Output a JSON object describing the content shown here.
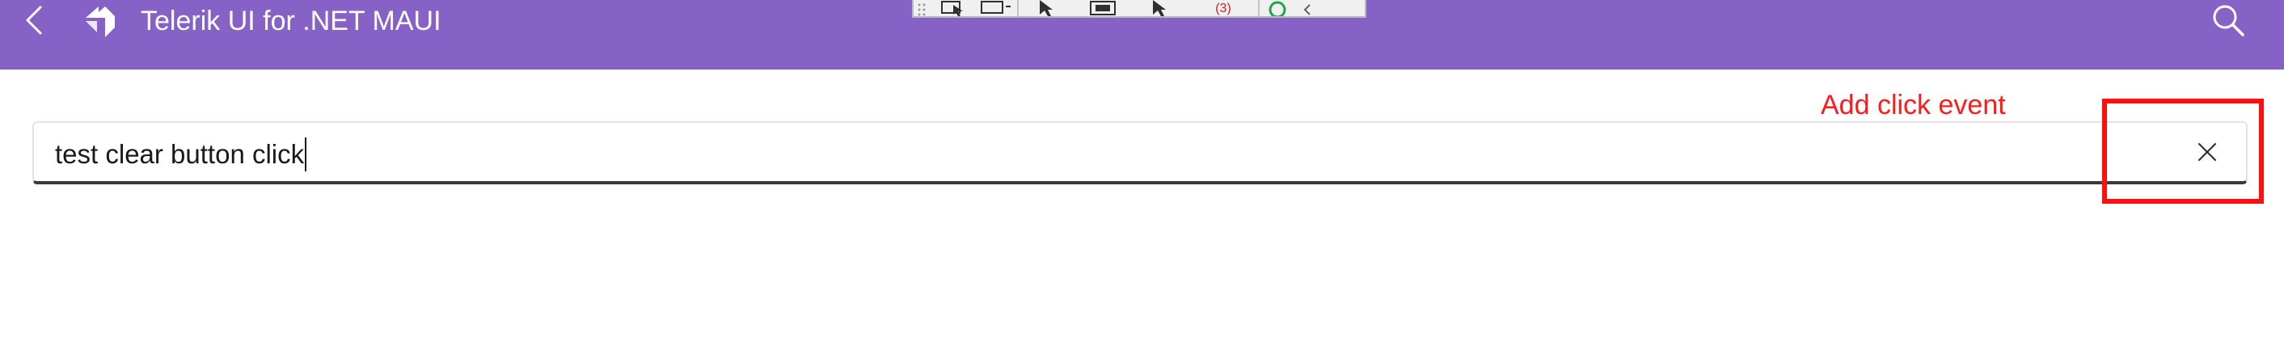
{
  "app_bar": {
    "title": "Telerik UI for .NET MAUI",
    "back_icon": "chevron-left-icon",
    "logo_icon": "telerik-logo-icon",
    "search_icon": "search-icon",
    "background_color": "#8662c7"
  },
  "debug_toolbar": {
    "counter_text": "(3)"
  },
  "entry": {
    "value": "test clear button click",
    "clear_icon": "close-icon"
  },
  "annotation": {
    "label": "Add click event",
    "color": "#ff1010"
  }
}
